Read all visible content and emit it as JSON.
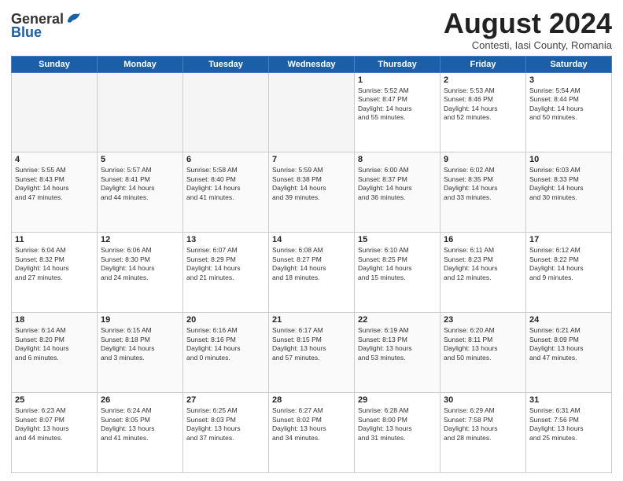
{
  "header": {
    "logo_general": "General",
    "logo_blue": "Blue",
    "month_title": "August 2024",
    "location": "Contesti, Iasi County, Romania"
  },
  "weekdays": [
    "Sunday",
    "Monday",
    "Tuesday",
    "Wednesday",
    "Thursday",
    "Friday",
    "Saturday"
  ],
  "weeks": [
    [
      {
        "day": "",
        "info": ""
      },
      {
        "day": "",
        "info": ""
      },
      {
        "day": "",
        "info": ""
      },
      {
        "day": "",
        "info": ""
      },
      {
        "day": "1",
        "info": "Sunrise: 5:52 AM\nSunset: 8:47 PM\nDaylight: 14 hours\nand 55 minutes."
      },
      {
        "day": "2",
        "info": "Sunrise: 5:53 AM\nSunset: 8:46 PM\nDaylight: 14 hours\nand 52 minutes."
      },
      {
        "day": "3",
        "info": "Sunrise: 5:54 AM\nSunset: 8:44 PM\nDaylight: 14 hours\nand 50 minutes."
      }
    ],
    [
      {
        "day": "4",
        "info": "Sunrise: 5:55 AM\nSunset: 8:43 PM\nDaylight: 14 hours\nand 47 minutes."
      },
      {
        "day": "5",
        "info": "Sunrise: 5:57 AM\nSunset: 8:41 PM\nDaylight: 14 hours\nand 44 minutes."
      },
      {
        "day": "6",
        "info": "Sunrise: 5:58 AM\nSunset: 8:40 PM\nDaylight: 14 hours\nand 41 minutes."
      },
      {
        "day": "7",
        "info": "Sunrise: 5:59 AM\nSunset: 8:38 PM\nDaylight: 14 hours\nand 39 minutes."
      },
      {
        "day": "8",
        "info": "Sunrise: 6:00 AM\nSunset: 8:37 PM\nDaylight: 14 hours\nand 36 minutes."
      },
      {
        "day": "9",
        "info": "Sunrise: 6:02 AM\nSunset: 8:35 PM\nDaylight: 14 hours\nand 33 minutes."
      },
      {
        "day": "10",
        "info": "Sunrise: 6:03 AM\nSunset: 8:33 PM\nDaylight: 14 hours\nand 30 minutes."
      }
    ],
    [
      {
        "day": "11",
        "info": "Sunrise: 6:04 AM\nSunset: 8:32 PM\nDaylight: 14 hours\nand 27 minutes."
      },
      {
        "day": "12",
        "info": "Sunrise: 6:06 AM\nSunset: 8:30 PM\nDaylight: 14 hours\nand 24 minutes."
      },
      {
        "day": "13",
        "info": "Sunrise: 6:07 AM\nSunset: 8:29 PM\nDaylight: 14 hours\nand 21 minutes."
      },
      {
        "day": "14",
        "info": "Sunrise: 6:08 AM\nSunset: 8:27 PM\nDaylight: 14 hours\nand 18 minutes."
      },
      {
        "day": "15",
        "info": "Sunrise: 6:10 AM\nSunset: 8:25 PM\nDaylight: 14 hours\nand 15 minutes."
      },
      {
        "day": "16",
        "info": "Sunrise: 6:11 AM\nSunset: 8:23 PM\nDaylight: 14 hours\nand 12 minutes."
      },
      {
        "day": "17",
        "info": "Sunrise: 6:12 AM\nSunset: 8:22 PM\nDaylight: 14 hours\nand 9 minutes."
      }
    ],
    [
      {
        "day": "18",
        "info": "Sunrise: 6:14 AM\nSunset: 8:20 PM\nDaylight: 14 hours\nand 6 minutes."
      },
      {
        "day": "19",
        "info": "Sunrise: 6:15 AM\nSunset: 8:18 PM\nDaylight: 14 hours\nand 3 minutes."
      },
      {
        "day": "20",
        "info": "Sunrise: 6:16 AM\nSunset: 8:16 PM\nDaylight: 14 hours\nand 0 minutes."
      },
      {
        "day": "21",
        "info": "Sunrise: 6:17 AM\nSunset: 8:15 PM\nDaylight: 13 hours\nand 57 minutes."
      },
      {
        "day": "22",
        "info": "Sunrise: 6:19 AM\nSunset: 8:13 PM\nDaylight: 13 hours\nand 53 minutes."
      },
      {
        "day": "23",
        "info": "Sunrise: 6:20 AM\nSunset: 8:11 PM\nDaylight: 13 hours\nand 50 minutes."
      },
      {
        "day": "24",
        "info": "Sunrise: 6:21 AM\nSunset: 8:09 PM\nDaylight: 13 hours\nand 47 minutes."
      }
    ],
    [
      {
        "day": "25",
        "info": "Sunrise: 6:23 AM\nSunset: 8:07 PM\nDaylight: 13 hours\nand 44 minutes."
      },
      {
        "day": "26",
        "info": "Sunrise: 6:24 AM\nSunset: 8:05 PM\nDaylight: 13 hours\nand 41 minutes."
      },
      {
        "day": "27",
        "info": "Sunrise: 6:25 AM\nSunset: 8:03 PM\nDaylight: 13 hours\nand 37 minutes."
      },
      {
        "day": "28",
        "info": "Sunrise: 6:27 AM\nSunset: 8:02 PM\nDaylight: 13 hours\nand 34 minutes."
      },
      {
        "day": "29",
        "info": "Sunrise: 6:28 AM\nSunset: 8:00 PM\nDaylight: 13 hours\nand 31 minutes."
      },
      {
        "day": "30",
        "info": "Sunrise: 6:29 AM\nSunset: 7:58 PM\nDaylight: 13 hours\nand 28 minutes."
      },
      {
        "day": "31",
        "info": "Sunrise: 6:31 AM\nSunset: 7:56 PM\nDaylight: 13 hours\nand 25 minutes."
      }
    ]
  ]
}
